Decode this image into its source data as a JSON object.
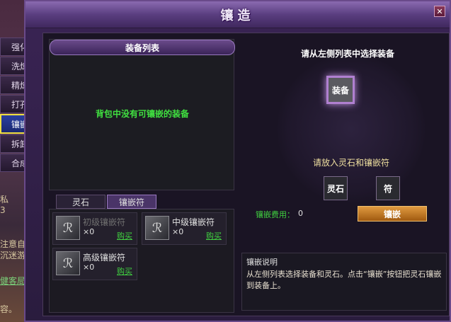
{
  "window": {
    "title": "镶造",
    "close_icon": "close-icon"
  },
  "left_menu": [
    "强化",
    "洗炼",
    "精炼",
    "打孔",
    "镶嵌",
    "拆卸",
    "合成"
  ],
  "left_side": {
    "chat_tab": "私",
    "chat_num": "3",
    "line1": "注意自我",
    "line2": "沉迷游戏",
    "link": "健客局游戏",
    "line3": "容。"
  },
  "equip_list": {
    "header": "装备列表",
    "empty_message": "背包中没有可镶嵌的装备"
  },
  "tabs": [
    "灵石",
    "镶嵌符"
  ],
  "stones": [
    {
      "name": "初级镶嵌符",
      "count": "×0",
      "buy": "购买",
      "dim": true
    },
    {
      "name": "中级镶嵌符",
      "count": "×0",
      "buy": "购买",
      "dim": false
    },
    {
      "name": "高级镶嵌符",
      "count": "×0",
      "buy": "购买",
      "dim": false
    }
  ],
  "right": {
    "instruction": "请从左侧列表中选择装备",
    "equip_slot": "装备",
    "place_hint": "请放入灵石和镶嵌符",
    "slot_stone": "灵石",
    "slot_rune": "符",
    "fee_label": "镶嵌费用：",
    "fee_value": "0",
    "embed_button": "镶嵌"
  },
  "description": {
    "title": "镶嵌说明",
    "text": "从左侧列表选择装备和灵石。点击“镶嵌”按钮把灵石镶嵌到装备上。"
  },
  "colors": {
    "accent_green": "#40d040",
    "highlight_yellow": "#f0e040",
    "button_orange": "#e09a40"
  }
}
